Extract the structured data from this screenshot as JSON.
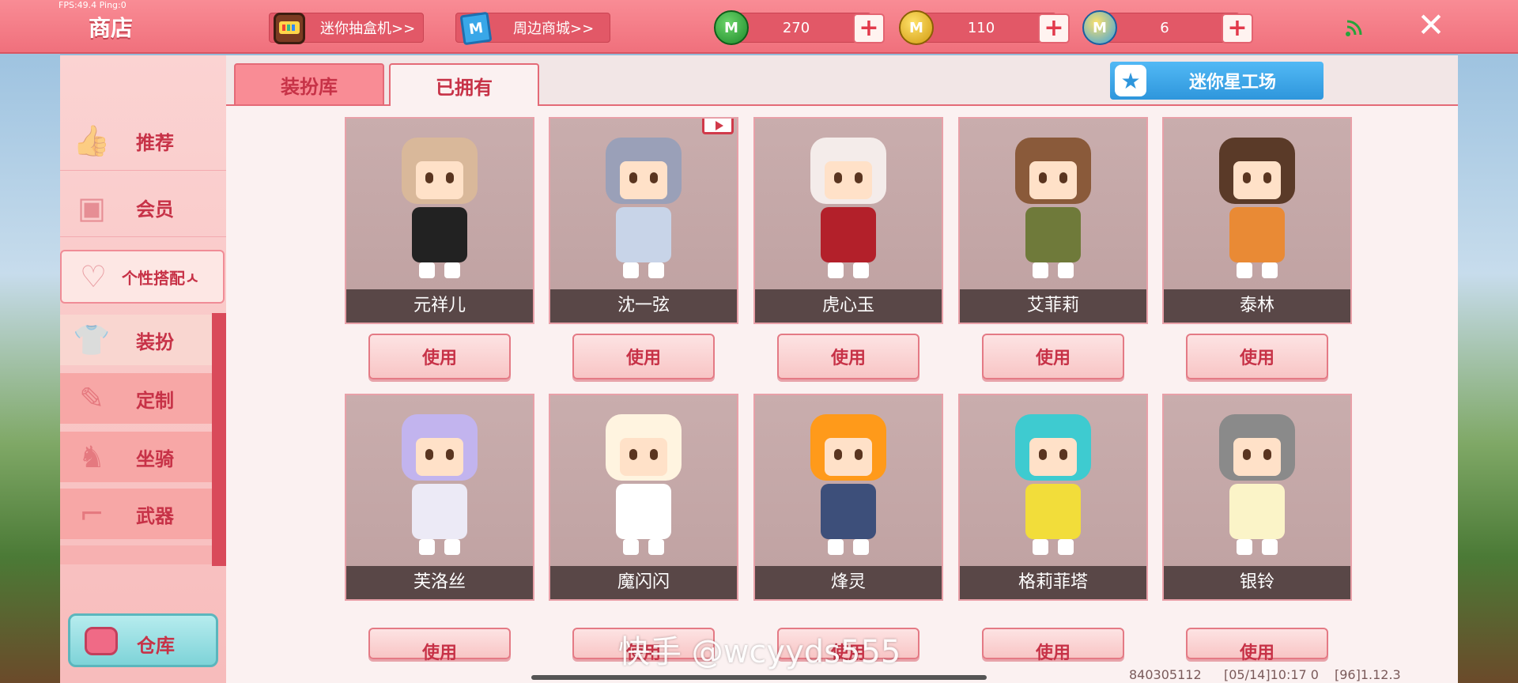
{
  "status": {
    "fps": "FPS:49.4  Ping:0"
  },
  "topbar": {
    "title": "商店",
    "gacha_label": "迷你抽盒机>>",
    "mall_label": "周边商城>>",
    "mall_icon_letter": "M",
    "currencies": [
      {
        "name": "green-mini-coin",
        "letter": "M",
        "amount": "270",
        "color": "#2fa33c"
      },
      {
        "name": "gold-mini-coin",
        "letter": "M",
        "amount": "110",
        "color": "#e2b21c"
      },
      {
        "name": "blue-mini-coin",
        "letter": "M",
        "amount": "6",
        "color": "#3aa0e0"
      }
    ],
    "plus_symbol": "+",
    "close_symbol": "✕",
    "wifi_symbol": "◔"
  },
  "sidebar": {
    "items": [
      {
        "label": "推荐",
        "icon": "thumbs-up-icon"
      },
      {
        "label": "会员",
        "icon": "vip-card-icon"
      },
      {
        "label": "个性搭配ㅅ",
        "icon": "heart-bubble-icon"
      },
      {
        "label": "装扮",
        "icon": "shirt-icon",
        "active": true
      },
      {
        "label": "定制",
        "icon": "brush-icon"
      },
      {
        "label": "坐骑",
        "icon": "mount-icon"
      },
      {
        "label": "武器",
        "icon": "gun-icon"
      }
    ],
    "warehouse_label": "仓库"
  },
  "tabs": [
    {
      "label": "装扮库",
      "active": false
    },
    {
      "label": "已拥有",
      "active": true
    }
  ],
  "workshop_label": "迷你星工场",
  "workshop_icon": "★",
  "use_label": "使用",
  "skins": [
    {
      "name": "元祥儿",
      "hair": "#d9b89a",
      "body": "#222222",
      "video": false
    },
    {
      "name": "沈一弦",
      "hair": "#9aa0b8",
      "body": "#c8d4e8",
      "video": true
    },
    {
      "name": "虎心玉",
      "hair": "#f4ecea",
      "body": "#b3202a",
      "video": false
    },
    {
      "name": "艾菲莉",
      "hair": "#8a5a3a",
      "body": "#6f7a3a",
      "video": false
    },
    {
      "name": "泰林",
      "hair": "#5a3a28",
      "body": "#e98a35",
      "video": false
    },
    {
      "name": "芙洛丝",
      "hair": "#c2b4ee",
      "body": "#eceaf6",
      "video": false
    },
    {
      "name": "魔闪闪",
      "hair": "#fff4e0",
      "body": "#ffffff",
      "video": false
    },
    {
      "name": "烽灵",
      "hair": "#ff9a1a",
      "body": "#3d4f7a",
      "video": false
    },
    {
      "name": "格莉菲塔",
      "hair": "#3ecbd0",
      "body": "#f2dd3a",
      "video": false
    },
    {
      "name": "银铃",
      "hair": "#8a8a8a",
      "body": "#fbf4c8",
      "video": false
    }
  ],
  "watermark": "快手 @wcyyds555",
  "footer": {
    "uid": "840305112",
    "time": "[05/14]10:17 0",
    "version": "[96]1.12.3"
  }
}
